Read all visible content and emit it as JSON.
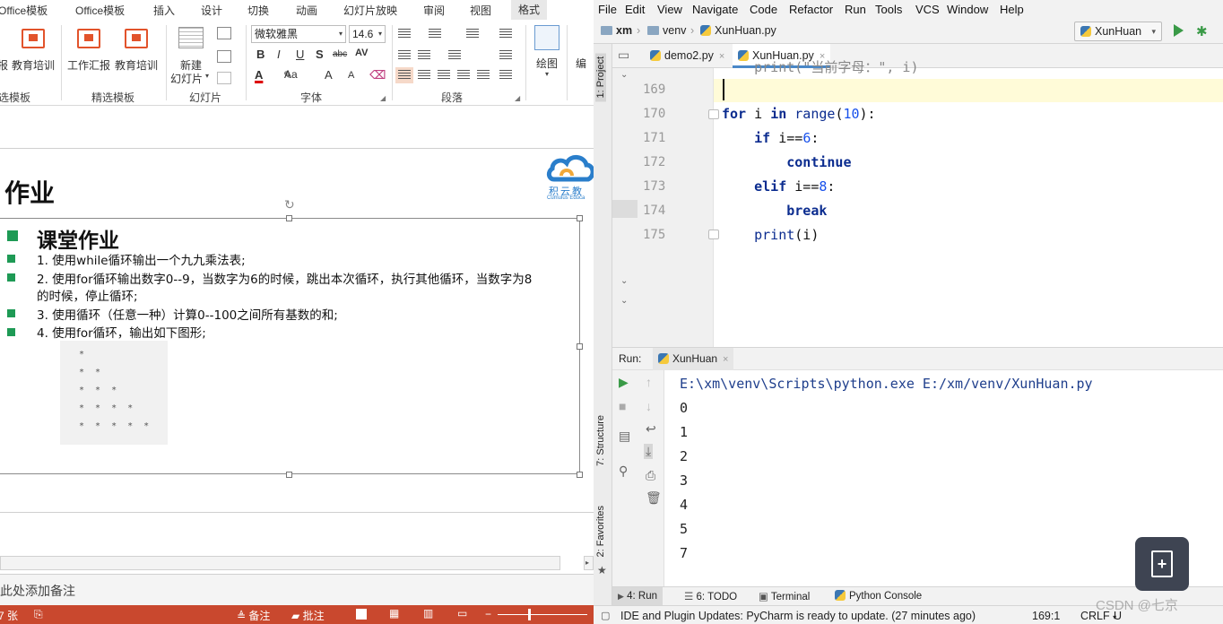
{
  "ppt": {
    "tabs": [
      "Office模板",
      "Office模板",
      "插入",
      "设计",
      "切换",
      "动画",
      "幻灯片放映",
      "审阅",
      "视图",
      "格式"
    ],
    "ribbon": {
      "template_btns": [
        "报",
        "教育培训",
        "工作汇报",
        "教育培训"
      ],
      "new_slide": [
        "新建",
        "幻灯片"
      ],
      "font_name": "微软雅黑",
      "font_size": "14.6",
      "draw_label": "绘图",
      "edit_label": "编",
      "groups": [
        "选模板",
        "精选模板",
        "幻灯片",
        "字体",
        "段落"
      ]
    },
    "slide": {
      "title": "作业",
      "logo_text": "积云教",
      "logo_sub": "Cumulus Educa",
      "subhead": "课堂作业",
      "lines": [
        "1. 使用while循环输出一个九九乘法表;",
        "2. 使用for循环输出数字0--9，当数字为6的时候，跳出本次循环，执行其他循环，当数字为8",
        "的时候，停止循环;",
        "3. 使用循环（任意一种）计算0--100之间所有基数的和;",
        "4. 使用for循环，输出如下图形;"
      ],
      "pattern": [
        "*",
        "* *",
        "* * *",
        "* * * *",
        "* * * * *"
      ]
    },
    "notes_placeholder": "此处添加备注",
    "status": {
      "slide_count": "7 张",
      "notes": "备注",
      "comments": "批注"
    }
  },
  "pycharm": {
    "menu": [
      "File",
      "Edit",
      "View",
      "Navigate",
      "Code",
      "Refactor",
      "Run",
      "Tools",
      "VCS",
      "Window",
      "Help"
    ],
    "breadcrumb": [
      "xm",
      "venv",
      "XunHuan.py"
    ],
    "run_config": "XunHuan",
    "editor_tabs": [
      {
        "name": "demo2.py"
      },
      {
        "name": "XunHuan.py"
      }
    ],
    "side_tabs": {
      "project": "1: Project",
      "structure": "7: Structure",
      "favorites": "2: Favorites"
    },
    "line_numbers": [
      "169",
      "170",
      "171",
      "172",
      "173",
      "174",
      "175"
    ],
    "partial_prev_line": "    print(\"当前字母：\", i)",
    "code": [
      {
        "indent": "",
        "kw1": "for",
        "rest1": " i ",
        "kw2": "in",
        "fn": " range",
        "open": "(",
        "num": "10",
        "close": "):"
      },
      {
        "indent": "    ",
        "kw1": "if",
        "rest1": " i==",
        "num": "6",
        "close": ":"
      },
      {
        "indent": "        ",
        "kw1": "continue"
      },
      {
        "indent": "    ",
        "kw1": "elif",
        "rest1": " i==",
        "num": "8",
        "close": ":"
      },
      {
        "indent": "        ",
        "kw1": "break"
      },
      {
        "indent": "    ",
        "fn": "print",
        "rest1": "(i)"
      }
    ],
    "run_label": "Run:",
    "run_tab": "XunHuan",
    "console": {
      "command": "E:\\xm\\venv\\Scripts\\python.exe E:/xm/venv/XunHuan.py",
      "output": [
        "0",
        "1",
        "2",
        "3",
        "4",
        "5",
        "7"
      ]
    },
    "bottom_tabs": [
      "4: Run",
      "6: TODO",
      "Terminal",
      "Python Console"
    ],
    "status": {
      "message": "IDE and Plugin Updates: PyCharm is ready to update. (27 minutes ago)",
      "position": "169:1",
      "line_sep": "CRLF",
      "encoding": "U"
    }
  },
  "watermark": "CSDN @七京"
}
